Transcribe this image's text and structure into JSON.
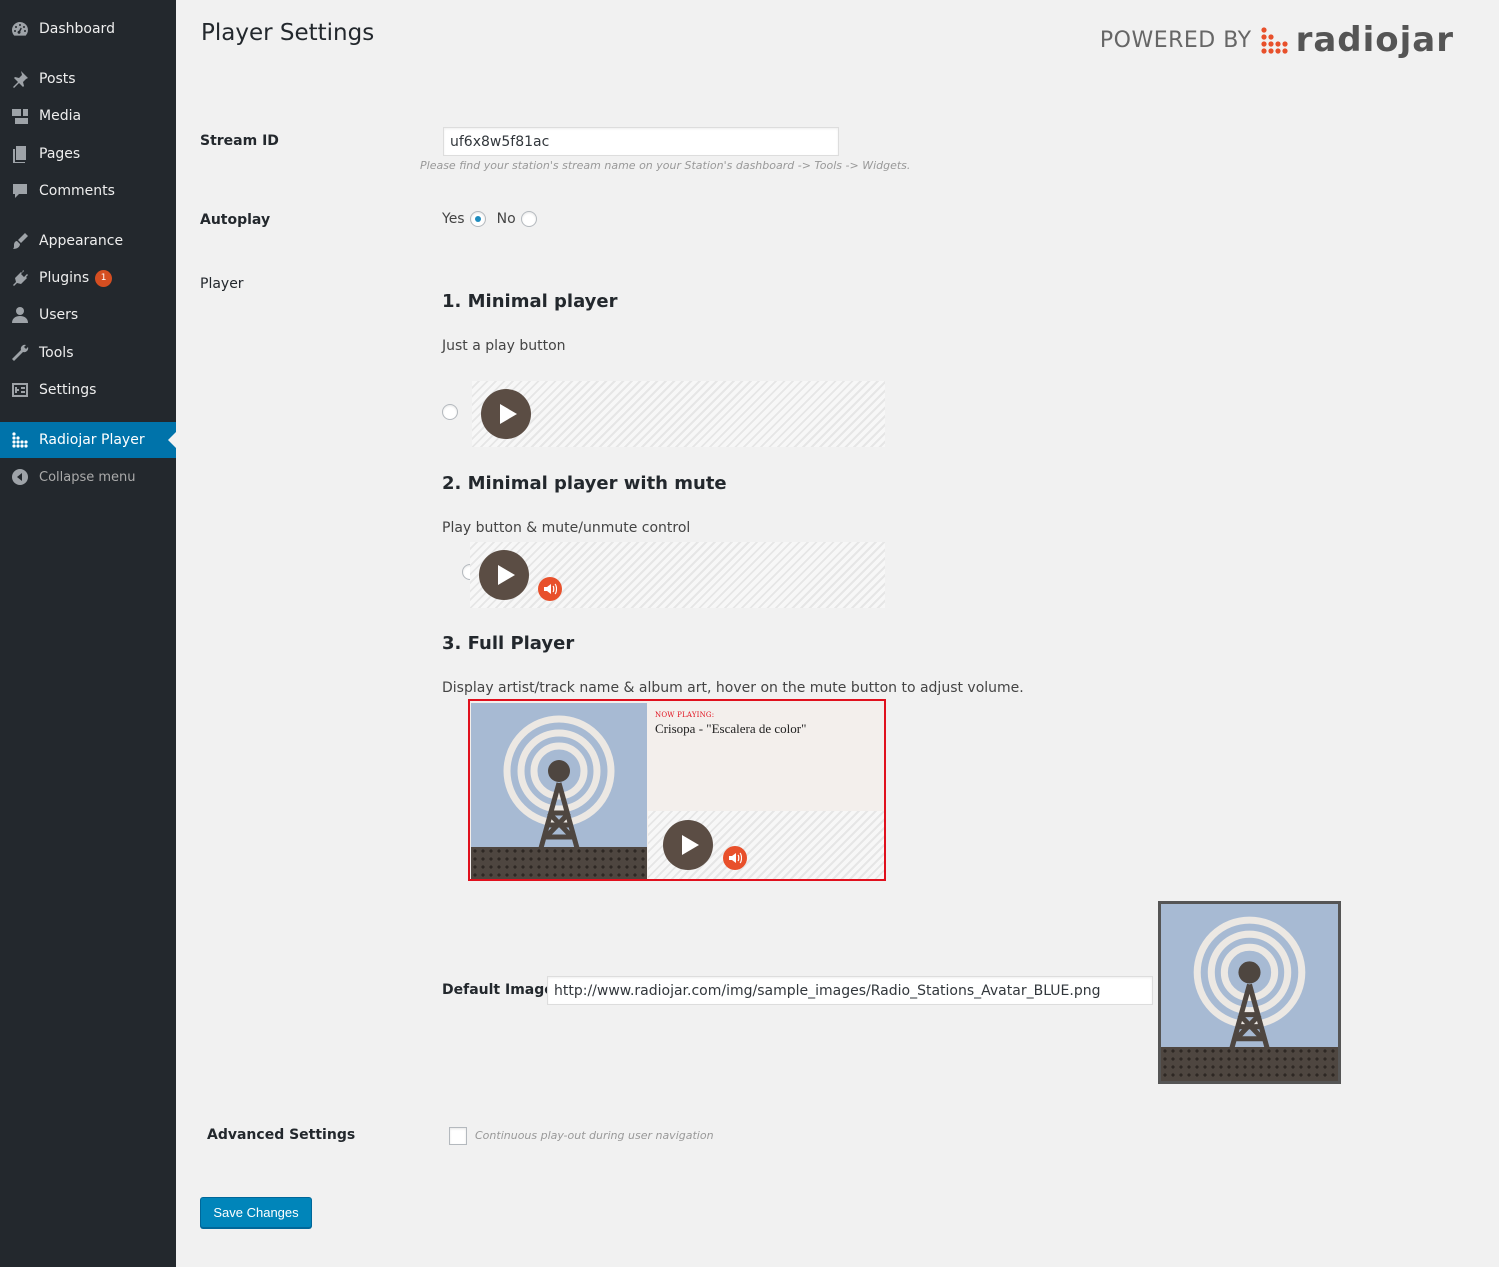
{
  "sidebar": {
    "items": [
      {
        "label": "Dashboard",
        "icon": "dashboard-icon"
      },
      {
        "label": "Posts",
        "icon": "pin-icon"
      },
      {
        "label": "Media",
        "icon": "media-icon"
      },
      {
        "label": "Pages",
        "icon": "pages-icon"
      },
      {
        "label": "Comments",
        "icon": "comment-icon"
      },
      {
        "label": "Appearance",
        "icon": "brush-icon"
      },
      {
        "label": "Plugins",
        "icon": "plugin-icon",
        "badge": "1"
      },
      {
        "label": "Users",
        "icon": "user-icon"
      },
      {
        "label": "Tools",
        "icon": "wrench-icon"
      },
      {
        "label": "Settings",
        "icon": "settings-icon"
      },
      {
        "label": "Radiojar Player",
        "icon": "radiojar-icon",
        "active": true
      },
      {
        "label": "Collapse menu",
        "icon": "collapse-icon"
      }
    ]
  },
  "header": {
    "title": "Player Settings",
    "powered_by": "POWERED BY",
    "brand": "radiojar"
  },
  "stream": {
    "label": "Stream ID",
    "value": "uf6x8w5f81ac",
    "description": "Please find your station's stream name on your Station's dashboard -> Tools -> Widgets."
  },
  "autoplay": {
    "label": "Autoplay",
    "yes_label": "Yes",
    "no_label": "No",
    "selected": "yes"
  },
  "player": {
    "label": "Player",
    "options": [
      {
        "title": "1. Minimal player",
        "description": "Just a play button",
        "selected": false
      },
      {
        "title": "2. Minimal player with mute",
        "description": "Play button & mute/unmute control",
        "selected": false
      },
      {
        "title": "3. Full Player",
        "description": "Display artist/track name & album art, hover on the mute button to adjust volume.",
        "selected": true
      }
    ],
    "now_playing_label": "NOW PLAYING:",
    "track": "Crisopa - \"Escalera de color\""
  },
  "default_image": {
    "label": "Default Image",
    "value": "http://www.radiojar.com/img/sample_images/Radio_Stations_Avatar_BLUE.png"
  },
  "advanced": {
    "label": "Advanced Settings",
    "checkbox_label": "Continuous play-out during user navigation",
    "checked": false
  },
  "save_label": "Save Changes",
  "colors": {
    "accent": "#0073aa",
    "brand_orange": "#e8502b",
    "highlight_border": "#e0101d"
  }
}
